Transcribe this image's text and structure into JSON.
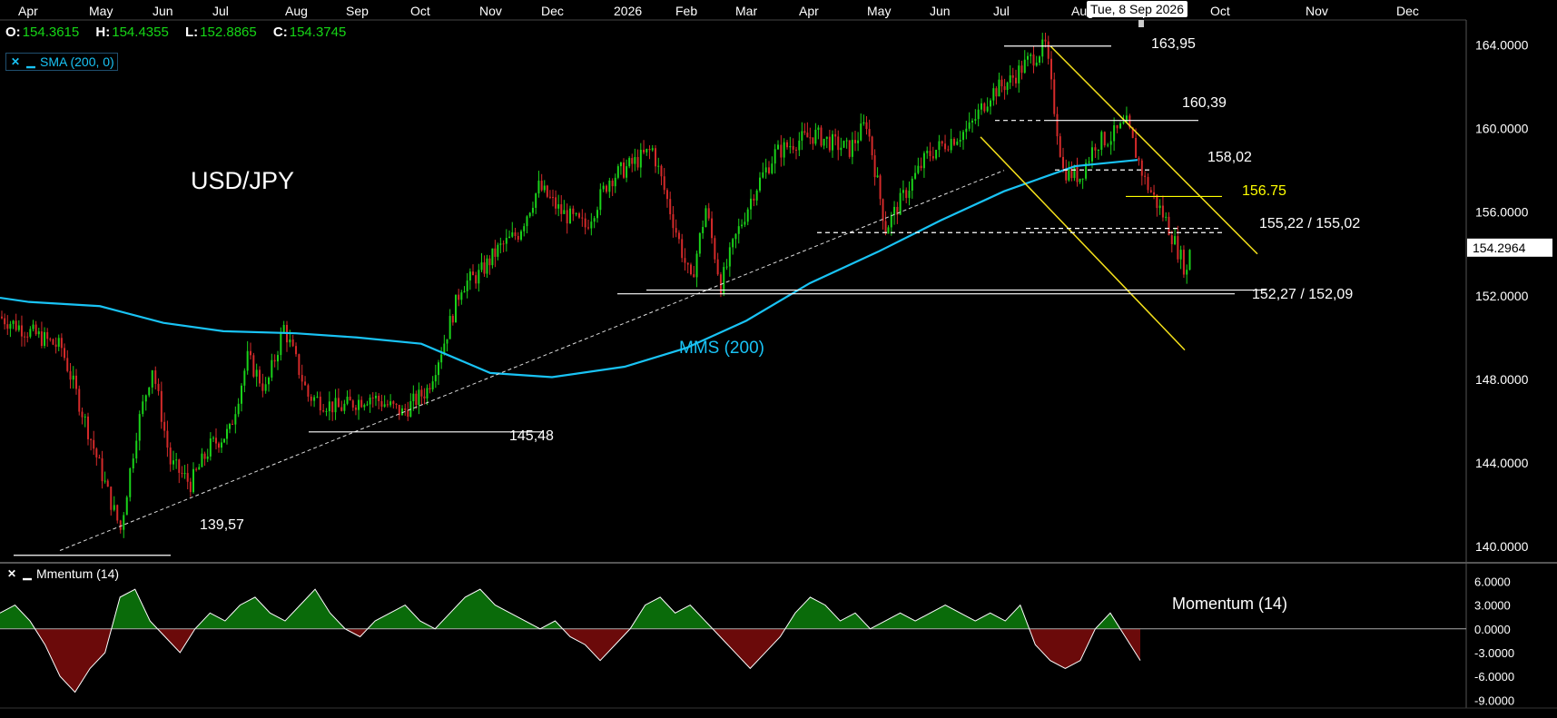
{
  "ohlc": {
    "o_label": "O:",
    "o_value": "154.3615",
    "h_label": "H:",
    "h_value": "154.4355",
    "l_label": "L:",
    "l_value": "152.8865",
    "c_label": "C:",
    "c_value": "154.3745"
  },
  "legend": {
    "close_icon": "close-icon",
    "minimize_icon": "minimize-icon",
    "sma_label": "SMA (200, 0)",
    "momentum_label": "Mmentum (14)"
  },
  "date_tip": "Tue, 8 Sep 2026",
  "current_price": "154.2964",
  "chart_data": [
    {
      "type": "candlestick",
      "symbol_title": "USD/JPY",
      "x_tick_labels": [
        "Apr",
        "May",
        "Jun",
        "Jul",
        "Aug",
        "Sep",
        "Oct",
        "Nov",
        "Dec",
        "2026",
        "Feb",
        "Mar",
        "Apr",
        "May",
        "Jun",
        "Jul",
        "Aug",
        "Sep",
        "Oct",
        "Nov",
        "Dec"
      ],
      "y_tick_labels": [
        "164.0000",
        "160.0000",
        "156.0000",
        "152.0000",
        "148.0000",
        "144.0000",
        "140.0000"
      ],
      "y_ticks": [
        164,
        160,
        156,
        152,
        148,
        144,
        140
      ],
      "ylim": [
        139.3,
        165.2
      ],
      "close_path": [
        [
          "Apr",
          151.0
        ],
        [
          "Apr",
          149.5
        ],
        [
          "Apr",
          146.0
        ],
        [
          "May",
          143.0
        ],
        [
          "May",
          140.8
        ],
        [
          "May",
          145.5
        ],
        [
          "May",
          148.6
        ],
        [
          "Jun",
          144.0
        ],
        [
          "Jun",
          143.0
        ],
        [
          "Jun",
          144.8
        ],
        [
          "Jul",
          145.5
        ],
        [
          "Jul",
          149.0
        ],
        [
          "Jul",
          147.5
        ],
        [
          "Jul",
          150.5
        ],
        [
          "Aug",
          147.2
        ],
        [
          "Aug",
          146.6
        ],
        [
          "Sep",
          147.2
        ],
        [
          "Sep",
          146.4
        ],
        [
          "Oct",
          147.5
        ],
        [
          "Oct",
          149.8
        ],
        [
          "Oct",
          152.5
        ],
        [
          "Oct",
          153.0
        ],
        [
          "Nov",
          154.2
        ],
        [
          "Nov",
          155.0
        ],
        [
          "Nov",
          157.2
        ],
        [
          "Dec",
          156.0
        ],
        [
          "Dec",
          155.3
        ],
        [
          "Dec",
          157.6
        ],
        [
          "2026",
          158.3
        ],
        [
          "2026",
          159.0
        ],
        [
          "2026",
          155.6
        ],
        [
          "Feb",
          152.6
        ],
        [
          "Feb",
          156.2
        ],
        [
          "Feb",
          152.5
        ],
        [
          "Feb",
          154.8
        ],
        [
          "Mar",
          157.0
        ],
        [
          "Mar",
          158.8
        ],
        [
          "Mar",
          159.4
        ],
        [
          "Apr",
          159.7
        ],
        [
          "Apr",
          159.3
        ],
        [
          "Apr",
          159.0
        ],
        [
          "Apr",
          160.3
        ],
        [
          "May",
          155.2
        ],
        [
          "May",
          157.0
        ],
        [
          "May",
          158.7
        ],
        [
          "Jun",
          159.4
        ],
        [
          "Jun",
          160.0
        ],
        [
          "Jun",
          161.7
        ],
        [
          "Jul",
          162.3
        ],
        [
          "Jul",
          163.2
        ],
        [
          "Jul",
          163.95
        ],
        [
          "Jul",
          158.0
        ],
        [
          "Aug",
          157.7
        ],
        [
          "Aug",
          159.3
        ],
        [
          "Aug",
          159.6
        ],
        [
          "Aug",
          160.2
        ],
        [
          "Sep",
          157.5
        ],
        [
          "Sep",
          155.6
        ],
        [
          "Sep",
          153.1
        ],
        [
          "Sep",
          154.37
        ]
      ],
      "series": [
        {
          "name": "SMA (200, 0)",
          "color": "#19c3f5",
          "values": [
            [
              "Apr",
              151.7
            ],
            [
              "May",
              151.5
            ],
            [
              "Jun",
              150.7
            ],
            [
              "Jul",
              150.3
            ],
            [
              "Aug",
              150.2
            ],
            [
              "Sep",
              150.0
            ],
            [
              "Oct",
              149.7
            ],
            [
              "Nov",
              148.3
            ],
            [
              "Dec",
              148.1
            ],
            [
              "2026",
              148.6
            ],
            [
              "Feb",
              149.5
            ],
            [
              "Mar",
              150.8
            ],
            [
              "Apr",
              152.6
            ],
            [
              "May",
              154.1
            ],
            [
              "Jun",
              155.6
            ],
            [
              "Jul",
              157.0
            ],
            [
              "Aug",
              158.2
            ],
            [
              "Sep",
              158.5
            ]
          ]
        }
      ],
      "colors": {
        "up": "#1ad21a",
        "down": "#d42a2a",
        "sma": "#19c3f5",
        "channel": "#f5e11b",
        "level": "#ffffff",
        "highlight": "#ffff00"
      },
      "annotations": {
        "sma_label": "MMS (200)",
        "levels": [
          {
            "label": "163,95",
            "y": 163.95,
            "style": "solid",
            "from": [
              "Jul",
              0.5
            ],
            "to": [
              "Aug",
              0.6
            ]
          },
          {
            "label": "160,39",
            "y": 160.39,
            "style": "mixed",
            "from": [
              "Jul",
              0.1
            ],
            "to": [
              "Sep",
              0.35
            ]
          },
          {
            "label": "158,02",
            "y": 158.02,
            "style": "dashed",
            "from": [
              "Aug",
              0.1
            ],
            "to": [
              "Sep",
              0.8
            ]
          },
          {
            "label": "156.75",
            "y": 156.75,
            "style": "highlight",
            "from": [
              "Sep",
              0.0
            ],
            "to": [
              "Sep",
              0.95
            ]
          },
          {
            "label": "155,22 / 155,02",
            "y": 155.22,
            "y2": 155.02,
            "style": "dashed",
            "from": [
              "May",
              0.0
            ],
            "to": [
              "Oct",
              0.1
            ]
          },
          {
            "label": "152,27 / 152,09",
            "y": 152.27,
            "y2": 152.09,
            "style": "solid",
            "from": [
              "Jan",
              0.9
            ],
            "to": [
              "Oct",
              0.3
            ]
          },
          {
            "label": "145,48",
            "y": 145.48,
            "style": "solid",
            "from": [
              "Aug",
              0.5
            ],
            "to": [
              "Dec",
              0.0
            ]
          },
          {
            "label": "139,57",
            "y": 139.57,
            "style": "solid",
            "from": [
              "Apr",
              0.0
            ],
            "to": [
              "Jun",
              0.6
            ]
          }
        ],
        "trendline": {
          "style": "dashed",
          "from": [
            "May",
            0.0,
            139.8
          ],
          "to": [
            "Jul",
            0.0,
            158.0
          ]
        },
        "channel": [
          {
            "from": [
              "Jul",
              0.5,
              163.95
            ],
            "to": [
              "Oct",
              0.4,
              150.4
            ]
          },
          {
            "from": [
              "Jun",
              0.5,
              158.8
            ],
            "to": [
              "Oct",
              0.05,
              143.8
            ]
          }
        ]
      }
    },
    {
      "type": "area",
      "title": "Momentum (14)",
      "y_tick_labels": [
        "6.0000",
        "3.0000",
        "0.0000",
        "-3.0000",
        "-6.0000",
        "-9.0000"
      ],
      "y_ticks": [
        6,
        3,
        0,
        -3,
        -6,
        -9
      ],
      "ylim": [
        -10,
        8
      ],
      "x_start": "Apr",
      "x_end": "Sep",
      "values": [
        2,
        3,
        1,
        -2,
        -6,
        -8,
        -5,
        -3,
        4,
        5,
        1,
        -1,
        -3,
        0,
        2,
        1,
        3,
        4,
        2,
        1,
        3,
        5,
        2,
        0,
        -1,
        1,
        2,
        3,
        1,
        0,
        2,
        4,
        5,
        3,
        2,
        1,
        0,
        1,
        -1,
        -2,
        -4,
        -2,
        0,
        3,
        4,
        2,
        3,
        1,
        -1,
        -3,
        -5,
        -3,
        -1,
        2,
        4,
        3,
        1,
        2,
        0,
        1,
        2,
        1,
        2,
        3,
        2,
        1,
        2,
        1,
        3,
        -2,
        -4,
        -5,
        -4,
        0,
        2,
        -1,
        -4
      ],
      "colors": {
        "pos": "#0a6b0a",
        "neg": "#6b0a0a",
        "line": "#ffffff"
      }
    }
  ]
}
